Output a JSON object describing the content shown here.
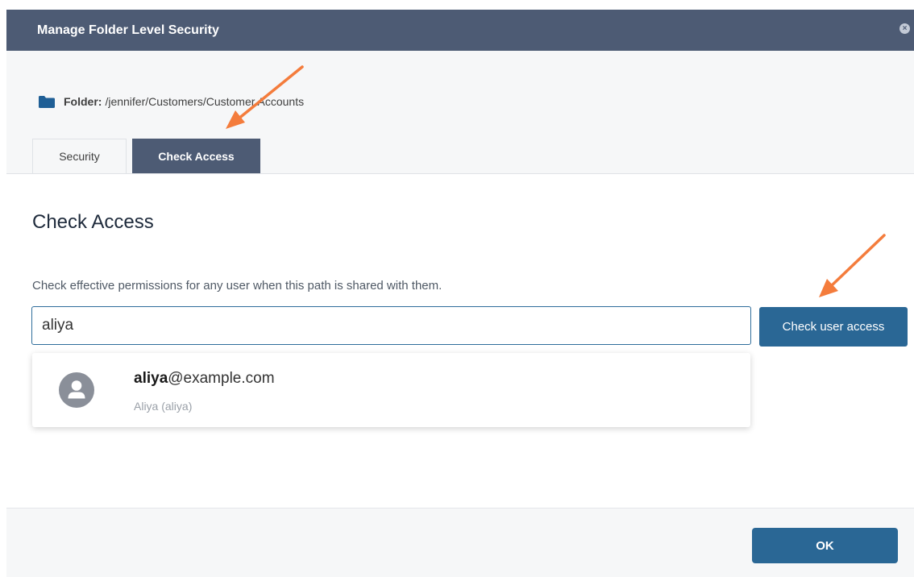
{
  "dialog": {
    "title": "Manage Folder Level Security",
    "close_label": "×"
  },
  "folder": {
    "label": "Folder:",
    "path": "/jennifer/Customers/Customer Accounts"
  },
  "tabs": [
    {
      "label": "Security",
      "active": false
    },
    {
      "label": "Check Access",
      "active": true
    }
  ],
  "check_access": {
    "heading": "Check Access",
    "description": "Check effective permissions for any user when this path is shared with them.",
    "search_value": "aliya",
    "button_label": "Check user access"
  },
  "suggestion": {
    "email_match": "aliya",
    "email_rest": "@example.com",
    "display_name": "Aliya (aliya)",
    "icon": "user-icon"
  },
  "footer": {
    "ok_label": "OK"
  },
  "colors": {
    "header": "#4d5b74",
    "primary_button": "#2a6795",
    "annotation_arrow": "#f47c3c"
  }
}
